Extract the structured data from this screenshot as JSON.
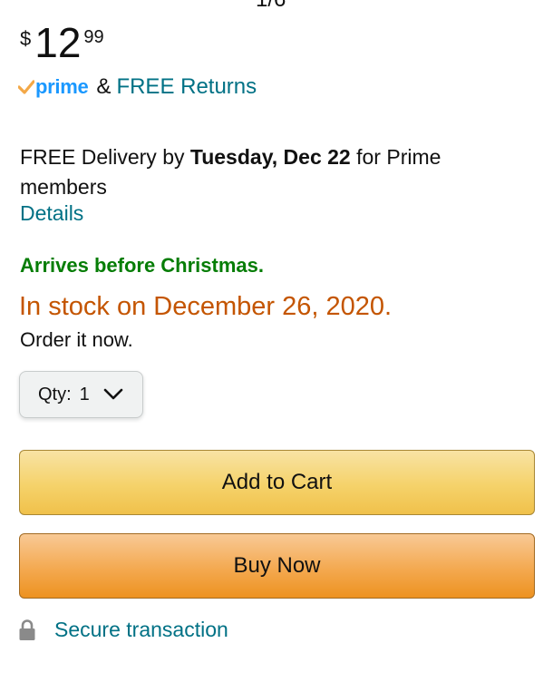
{
  "top_cut_text": "1/6",
  "price": {
    "symbol": "$",
    "whole": "12",
    "fraction": "99"
  },
  "prime": {
    "logo_text": "prime",
    "ampersand": "&",
    "returns_link": "FREE Returns"
  },
  "delivery": {
    "prefix": "FREE Delivery by ",
    "date": "Tuesday, Dec 22",
    "suffix": " for Prime members",
    "details_link": "Details"
  },
  "arrives_message": "Arrives before Christmas.",
  "stock_status": "In stock on December 26, 2020.",
  "order_prompt": "Order it now.",
  "quantity": {
    "label": "Qty:",
    "value": "1"
  },
  "buttons": {
    "add_to_cart": "Add to Cart",
    "buy_now": "Buy Now"
  },
  "secure": {
    "label": "Secure transaction"
  },
  "colors": {
    "link": "#007185",
    "prime_blue": "#1a98ff",
    "prime_check": "#f3a847",
    "success_green": "#067d06",
    "stock_orange": "#c45500",
    "add_to_cart_yellow": "#f0c14b",
    "buy_now_orange": "#ed9220"
  },
  "icons": {
    "prime_check": "prime-check-icon",
    "chevron": "chevron-down-icon",
    "lock": "lock-icon"
  }
}
